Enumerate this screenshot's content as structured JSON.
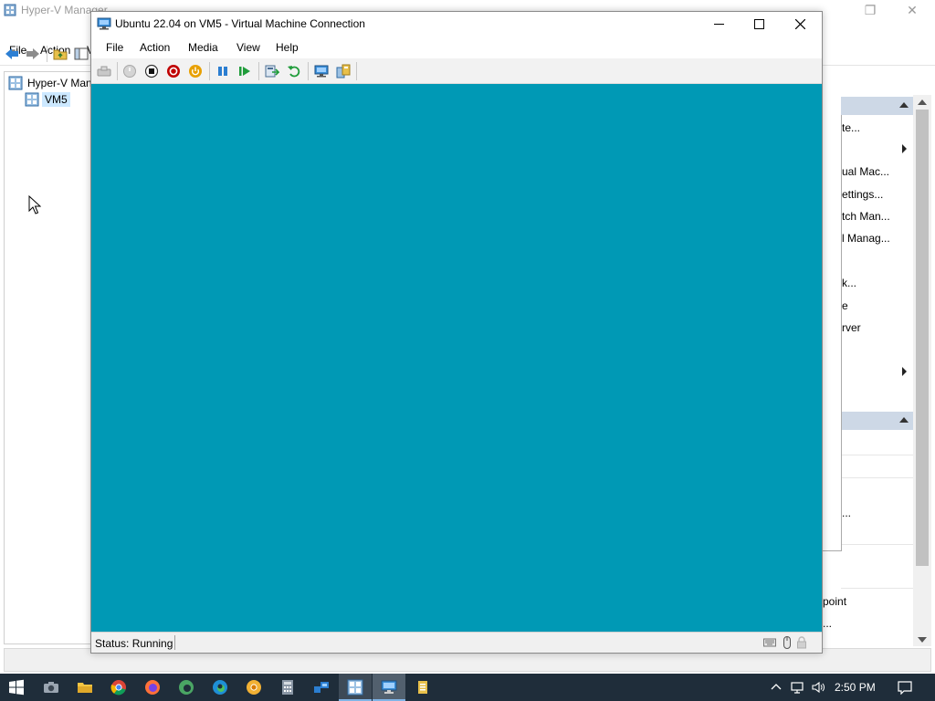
{
  "background_window": {
    "title": "Hyper-V Manager",
    "menu": [
      "File",
      "Action",
      "V"
    ],
    "tree": {
      "root": "Hyper-V Man",
      "server": "VM5"
    },
    "actions": {
      "items": [
        "te...",
        "ual Mac...",
        "ettings...",
        "tch Man...",
        "l Manag...",
        "k...",
        "e",
        "rver",
        "...",
        "point",
        "..."
      ]
    }
  },
  "vm_window": {
    "title": "Ubuntu 22.04 on VM5 - Virtual Machine Connection",
    "menu": [
      "File",
      "Action",
      "Media",
      "View",
      "Help"
    ],
    "status": "Status: Running",
    "screen_color": "#0099b5"
  },
  "toolbar_icons": [
    "ctrl-alt-del-icon",
    "start-icon",
    "turn-off-icon",
    "shut-down-icon",
    "save-icon",
    "pause-icon",
    "resume-icon",
    "checkpoint-icon",
    "revert-icon",
    "enhanced-session-icon",
    "share-icon"
  ],
  "taskbar": {
    "clock": "2:50 PM",
    "apps": [
      "start-icon",
      "camera-icon",
      "file-explorer-icon",
      "chrome-icon",
      "firefox-icon",
      "edge-dev-icon",
      "edge-icon",
      "chrome-canary-icon",
      "calculator-icon",
      "people-icon",
      "hyper-v-manager-icon",
      "vm-connection-icon",
      "notepad-icon"
    ]
  },
  "colors": {
    "accent": "#0099b5",
    "taskbar": "#1f2d3a",
    "stop_red": "#c00000",
    "shutdown_orange": "#e8a000",
    "play_green": "#1f9c3a"
  }
}
